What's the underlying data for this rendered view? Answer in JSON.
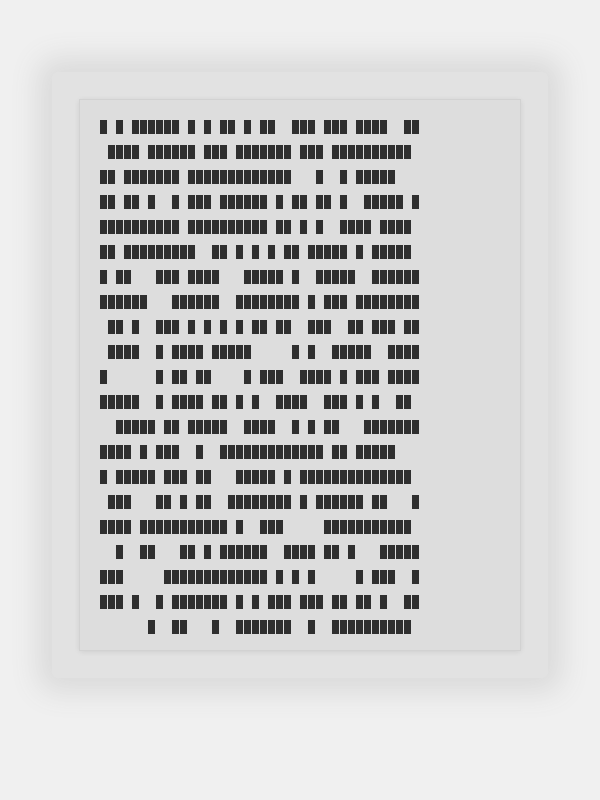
{
  "document": {
    "cell_count_note": "",
    "lines": [
      "█ █ ██████ █ █ ██ █ ██  ███ ███ ████  ██",
      " ████ ██████ ███ ███████ ███ ██████████",
      "██ ███████ █████████████   █  █ █████",
      "██ ██ █  █ ███ ██████ █ ██ ██ █  █████ █",
      "██████████ ██████████ ██ █ █  ████ ████",
      "██ █████████  ██ █ █ █ ██ █████ █ █████",
      "█ ██   ███ ████   █████ █  █████  ██████",
      "██████   ██████  ████████ █ ███ ████████",
      " ██ █  ███ █ █ █ █ ██ ██  ███  ██ ███ ██",
      " ████  █ ████ █████     █ █  █████  ████",
      "█      █ ██ ██    █ ███  ████ █ ███ ████",
      "█████  █ ████ ██ █ █  ████  ███ █ █  ██",
      "  █████ ██ █████  ████  █ █ ██   ███████",
      "████ █ ███  █  █████████████ ██ █████",
      "█ █████ ███ ██   █████ █ ██████████████",
      " ███   ██ █ ██  ████████ █ ██████ ██   █",
      "████ ███████████ █  ███     ███████████",
      "  █  ██   ██ █ ██████  ████ ██ █   █████",
      "███     █████████████ █ █ █     █ ███  █",
      "███ █  █ ███████ █ █ ███ ███ ██ ██ █  ██",
      "      █  ██   █  ███████  █  ██████████"
    ]
  }
}
